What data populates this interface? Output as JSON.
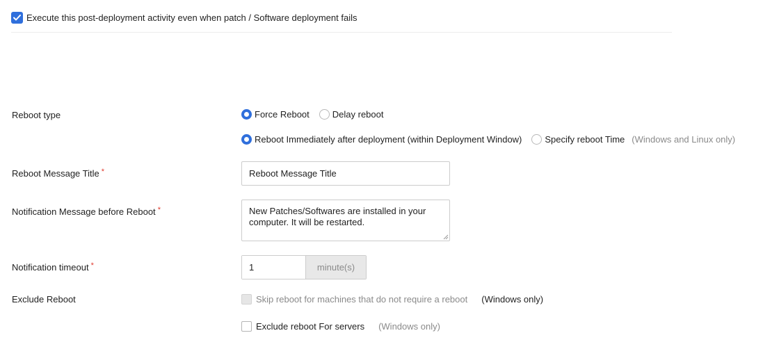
{
  "post_deployment": {
    "checked": true,
    "label": "Execute this post-deployment activity even when patch / Software deployment fails"
  },
  "reboot_type": {
    "label": "Reboot type",
    "options": [
      {
        "label": "Force Reboot",
        "selected": true
      },
      {
        "label": "Delay reboot",
        "selected": false
      }
    ],
    "timing_options": [
      {
        "label": "Reboot Immediately after deployment (within Deployment Window)",
        "selected": true
      },
      {
        "label": "Specify reboot Time",
        "selected": false
      }
    ],
    "timing_note": "(Windows and Linux only)"
  },
  "reboot_message_title": {
    "label": "Reboot Message Title",
    "required_mark": "*",
    "value": "Reboot Message Title"
  },
  "notification_message": {
    "label": "Notification Message before Reboot",
    "required_mark": "*",
    "value": "New Patches/Softwares are installed in your computer. It will be restarted."
  },
  "notification_timeout": {
    "label": "Notification timeout",
    "required_mark": "*",
    "value": "1",
    "unit": "minute(s)"
  },
  "exclude_reboot": {
    "label": "Exclude Reboot",
    "skip_option": {
      "label": "Skip reboot for machines that do not require a reboot",
      "note": "(Windows only)",
      "checked": false,
      "disabled": true
    },
    "servers_option": {
      "label": "Exclude reboot For servers",
      "note": "(Windows only)",
      "checked": false
    }
  },
  "colors": {
    "accent": "#2f6fdc",
    "required": "#e0392d",
    "muted_text": "#8a8a8a"
  }
}
